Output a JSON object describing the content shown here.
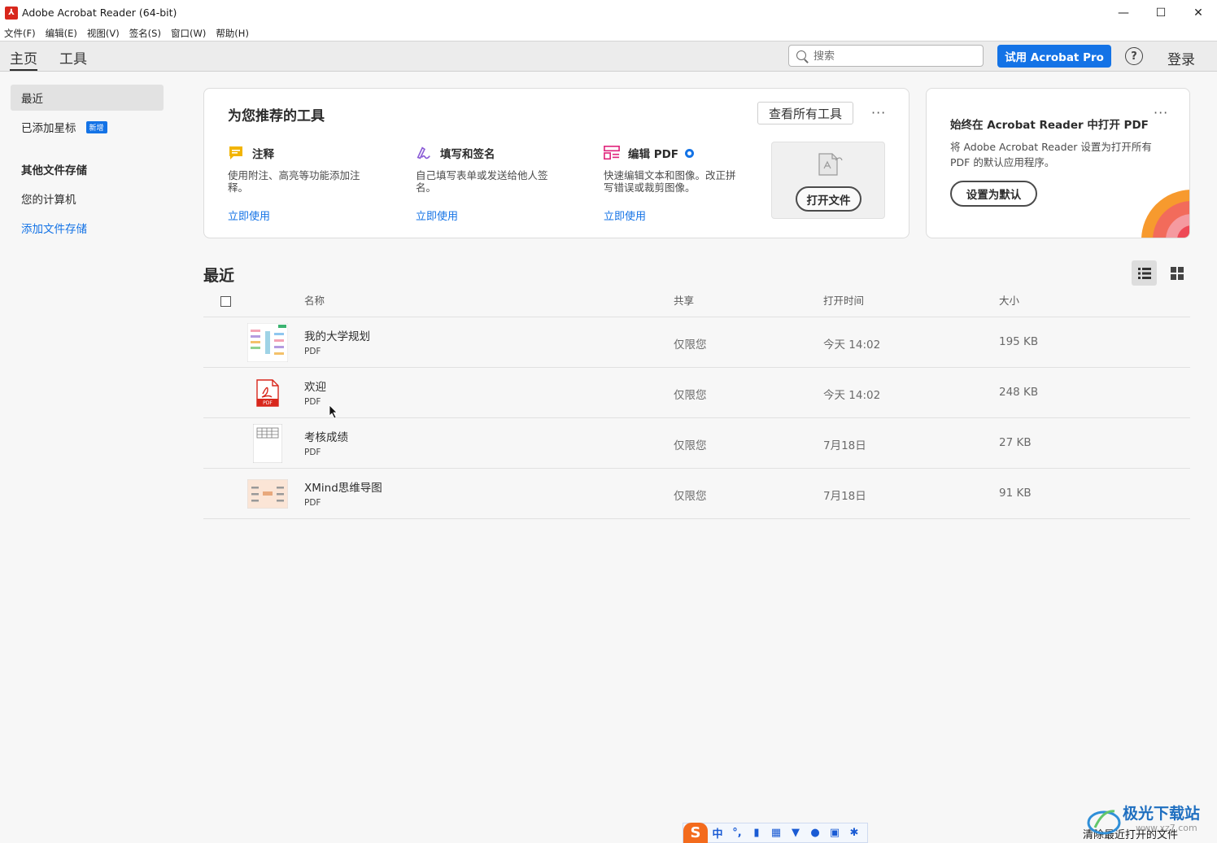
{
  "window": {
    "title": "Adobe Acrobat Reader (64-bit)",
    "controls": {
      "minimize": "—",
      "maximize": "☐",
      "close": "✕"
    }
  },
  "menu": [
    "文件(F)",
    "编辑(E)",
    "视图(V)",
    "签名(S)",
    "窗口(W)",
    "帮助(H)"
  ],
  "topbar": {
    "tabs": [
      "主页",
      "工具"
    ],
    "search_placeholder": "搜索",
    "try_pro": "试用 Acrobat Pro",
    "help": "?",
    "login": "登录"
  },
  "sidebar": {
    "recent": "最近",
    "starred": "已添加星标",
    "starred_badge": "新增",
    "other_storage": "其他文件存储",
    "your_computer": "您的计算机",
    "add_storage": "添加文件存储"
  },
  "tools_card": {
    "title": "为您推荐的工具",
    "view_all": "查看所有工具",
    "more": "···",
    "tools": [
      {
        "name": "注释",
        "desc": "使用附注、高亮等功能添加注释。",
        "link": "立即使用",
        "icon": "comment-icon",
        "color": "#f2b400"
      },
      {
        "name": "填写和签名",
        "desc": "自己填写表单或发送给他人签名。",
        "link": "立即使用",
        "icon": "fill-sign-icon",
        "color": "#8b5cd6"
      },
      {
        "name": "编辑 PDF",
        "desc": "快速编辑文本和图像。改正拼写错误或裁剪图像。",
        "link": "立即使用",
        "icon": "edit-pdf-icon",
        "color": "#e0267d"
      }
    ],
    "open_file": "打开文件"
  },
  "default_card": {
    "title": "始终在 Acrobat Reader 中打开 PDF",
    "desc": "将 Adobe Acrobat Reader 设置为打开所有 PDF 的默认应用程序。",
    "button": "设置为默认",
    "more": "···"
  },
  "recent": {
    "title": "最近",
    "columns": {
      "name": "名称",
      "shared": "共享",
      "opened": "打开时间",
      "size": "大小"
    },
    "files": [
      {
        "name": "我的大学规划",
        "type": "PDF",
        "shared": "仅限您",
        "opened": "今天 14:02",
        "size": "195 KB",
        "thumb": "mindmap-thumb"
      },
      {
        "name": "欢迎",
        "type": "PDF",
        "shared": "仅限您",
        "opened": "今天 14:02",
        "size": "248 KB",
        "thumb": "pdf-icon"
      },
      {
        "name": "考核成绩",
        "type": "PDF",
        "shared": "仅限您",
        "opened": "7月18日",
        "size": "27 KB",
        "thumb": "table-thumb"
      },
      {
        "name": "XMind思维导图",
        "type": "PDF",
        "shared": "仅限您",
        "opened": "7月18日",
        "size": "91 KB",
        "thumb": "xmind-thumb"
      }
    ]
  },
  "footer": {
    "clear_recent": "清除最近打开的文件",
    "ime_logo": "S",
    "ime_mode": "中",
    "watermark": "极光下载站",
    "watermark_sub": "www.xz7.com"
  }
}
